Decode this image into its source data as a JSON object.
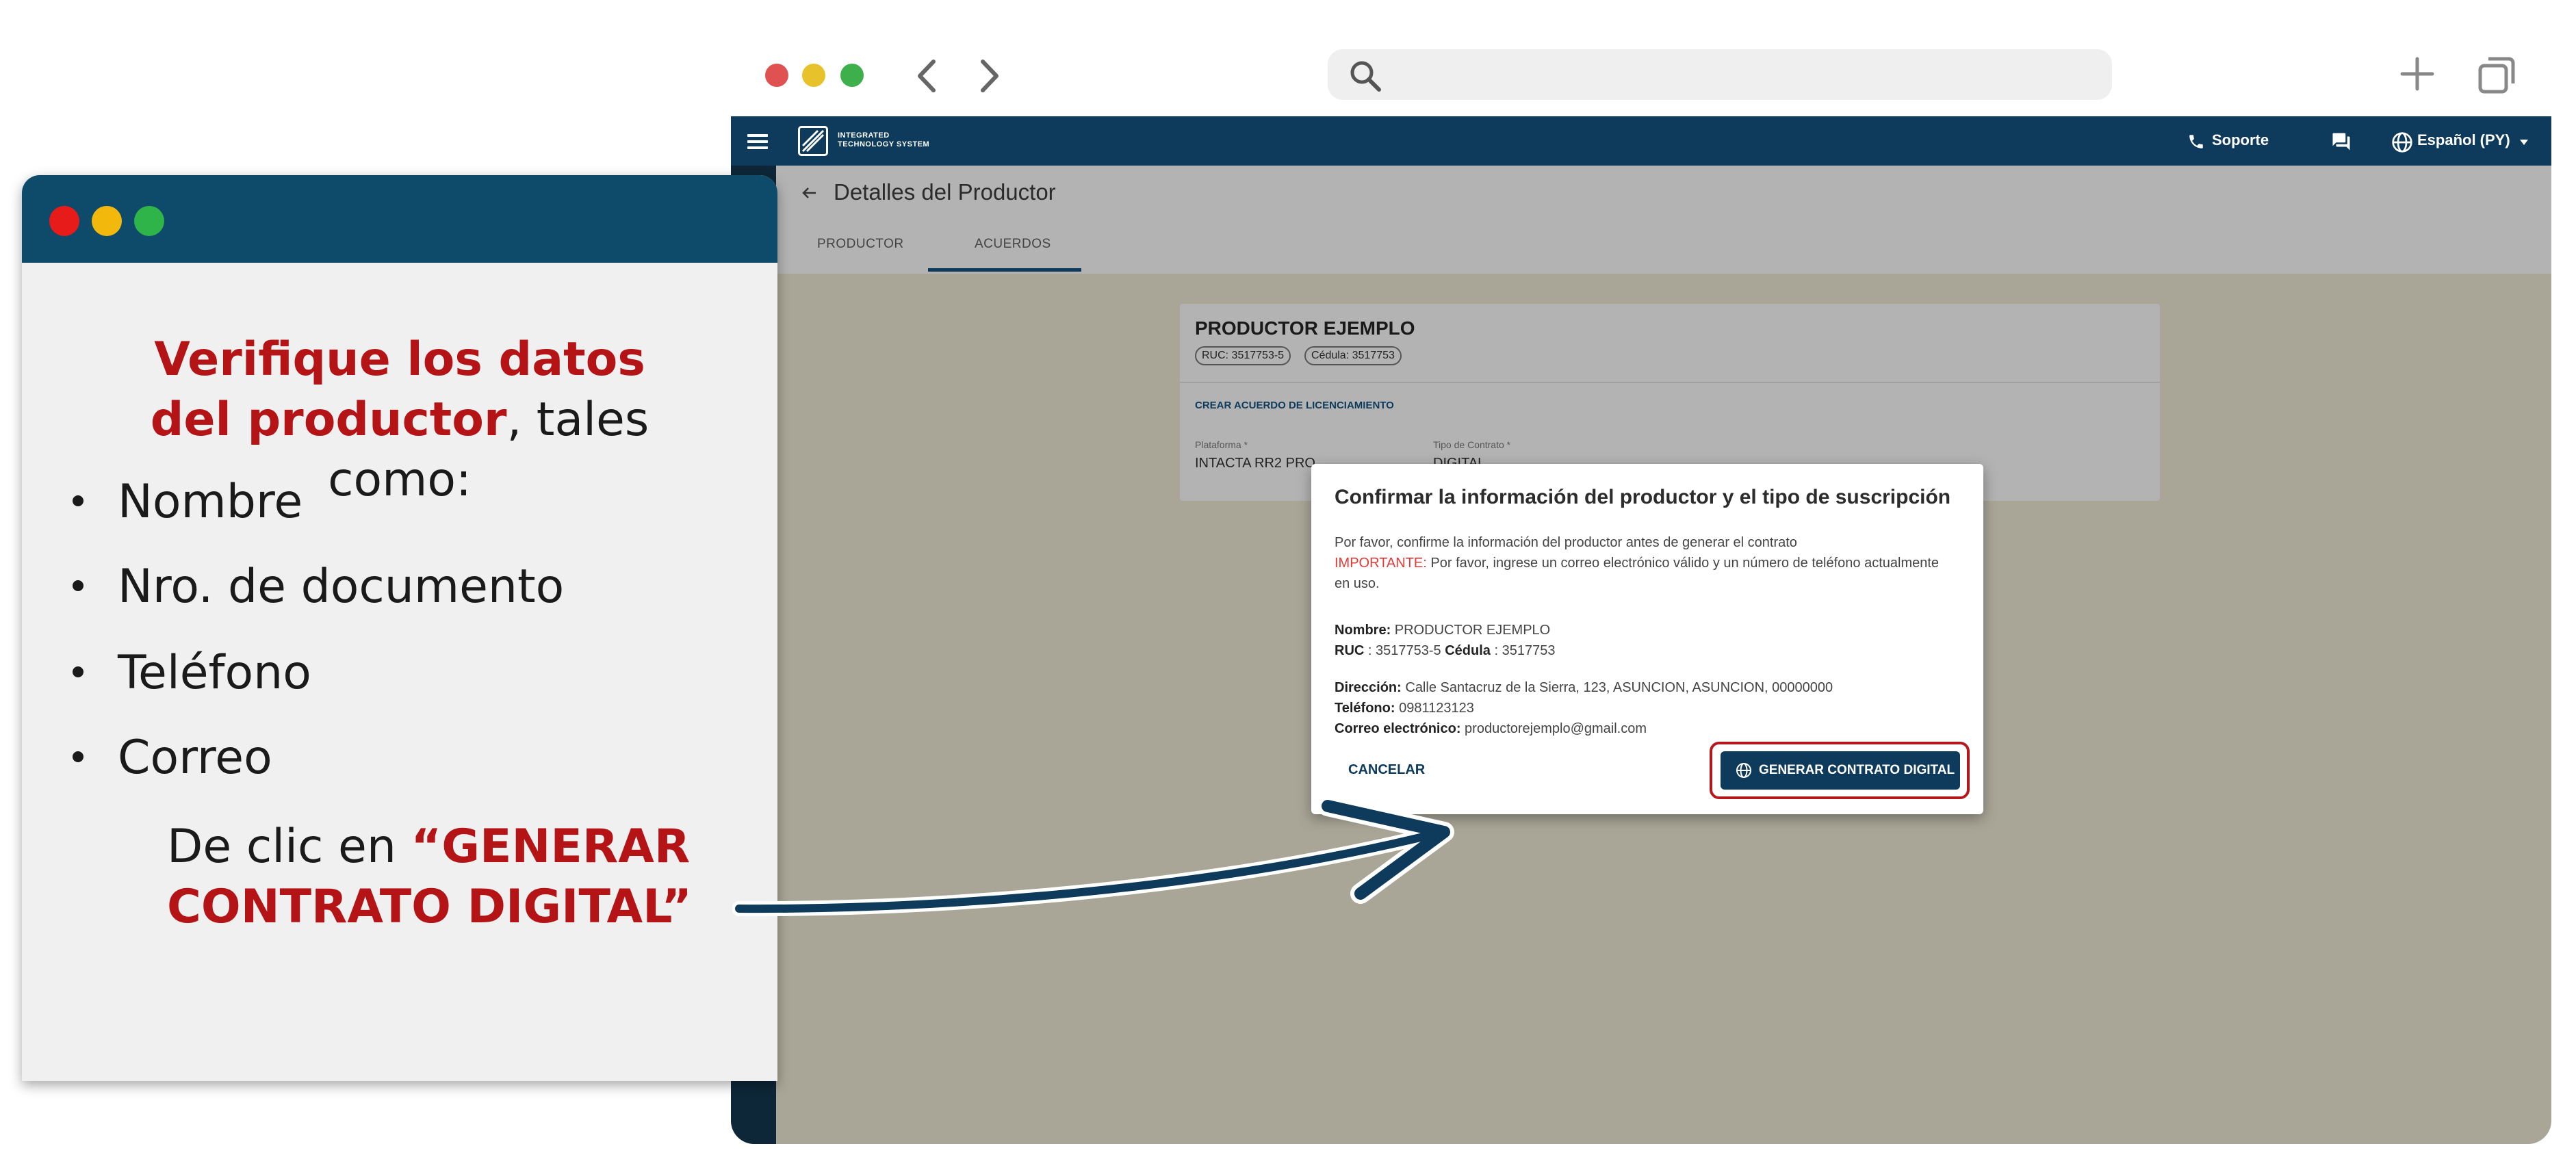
{
  "browser": {
    "url_value": ""
  },
  "app": {
    "logo_line1": "INTEGRATED",
    "logo_line2": "TECHNOLOGY SYSTEM",
    "support_label": "Soporte",
    "language_label": "Español (PY)",
    "page_title": "Detalles del Productor",
    "tabs": [
      {
        "label": "PRODUCTOR"
      },
      {
        "label": "ACUERDOS"
      }
    ],
    "card": {
      "producer_name": "PRODUCTOR EJEMPLO",
      "ruc_chip": "RUC: 3517753-5",
      "cedula_chip": "Cédula: 3517753",
      "section_title": "CREAR ACUERDO DE LICENCIAMIENTO",
      "platform_label": "Plataforma *",
      "platform_value": "INTACTA RR2 PRO",
      "contract_type_label": "Tipo de Contrato *",
      "contract_type_value": "DIGITAL"
    }
  },
  "dialog": {
    "title": "Confirmar la información del productor y el tipo de suscripción",
    "intro": "Por favor, confirme la información del productor antes de generar el contrato",
    "important_label": "IMPORTANTE:",
    "important_text": " Por favor, ingrese un correo electrónico válido y un número de teléfono actualmente en uso.",
    "nombre_label": "Nombre:",
    "nombre_value": " PRODUCTOR EJEMPLO",
    "ruc_label": "RUC",
    "ruc_value": " : 3517753-5 ",
    "cedula_label": "Cédula",
    "cedula_value": " : 3517753",
    "direccion_label": "Dirección:",
    "direccion_value": " Calle Santacruz de la Sierra, 123, ASUNCION, ASUNCION, 00000000",
    "telefono_label": "Teléfono:",
    "telefono_value": " 0981123123",
    "correo_label": "Correo electrónico:",
    "correo_value": " productorejemplo@gmail.com",
    "cancel_label": "CANCELAR",
    "generate_label": "GENERAR CONTRATO DIGITAL"
  },
  "instructions": {
    "title_highlight": "Verifique los datos del productor",
    "title_rest": ", tales como:",
    "bullets": [
      "Nombre",
      "Nro. de documento",
      "Teléfono",
      "Correo"
    ],
    "cta_prefix": "De clic en ",
    "cta_highlight": "“GENERAR CONTRATO DIGITAL”"
  },
  "colors": {
    "navy": "#0e3b5b",
    "accent_red": "#b51416",
    "overlay": "#a9a697"
  }
}
